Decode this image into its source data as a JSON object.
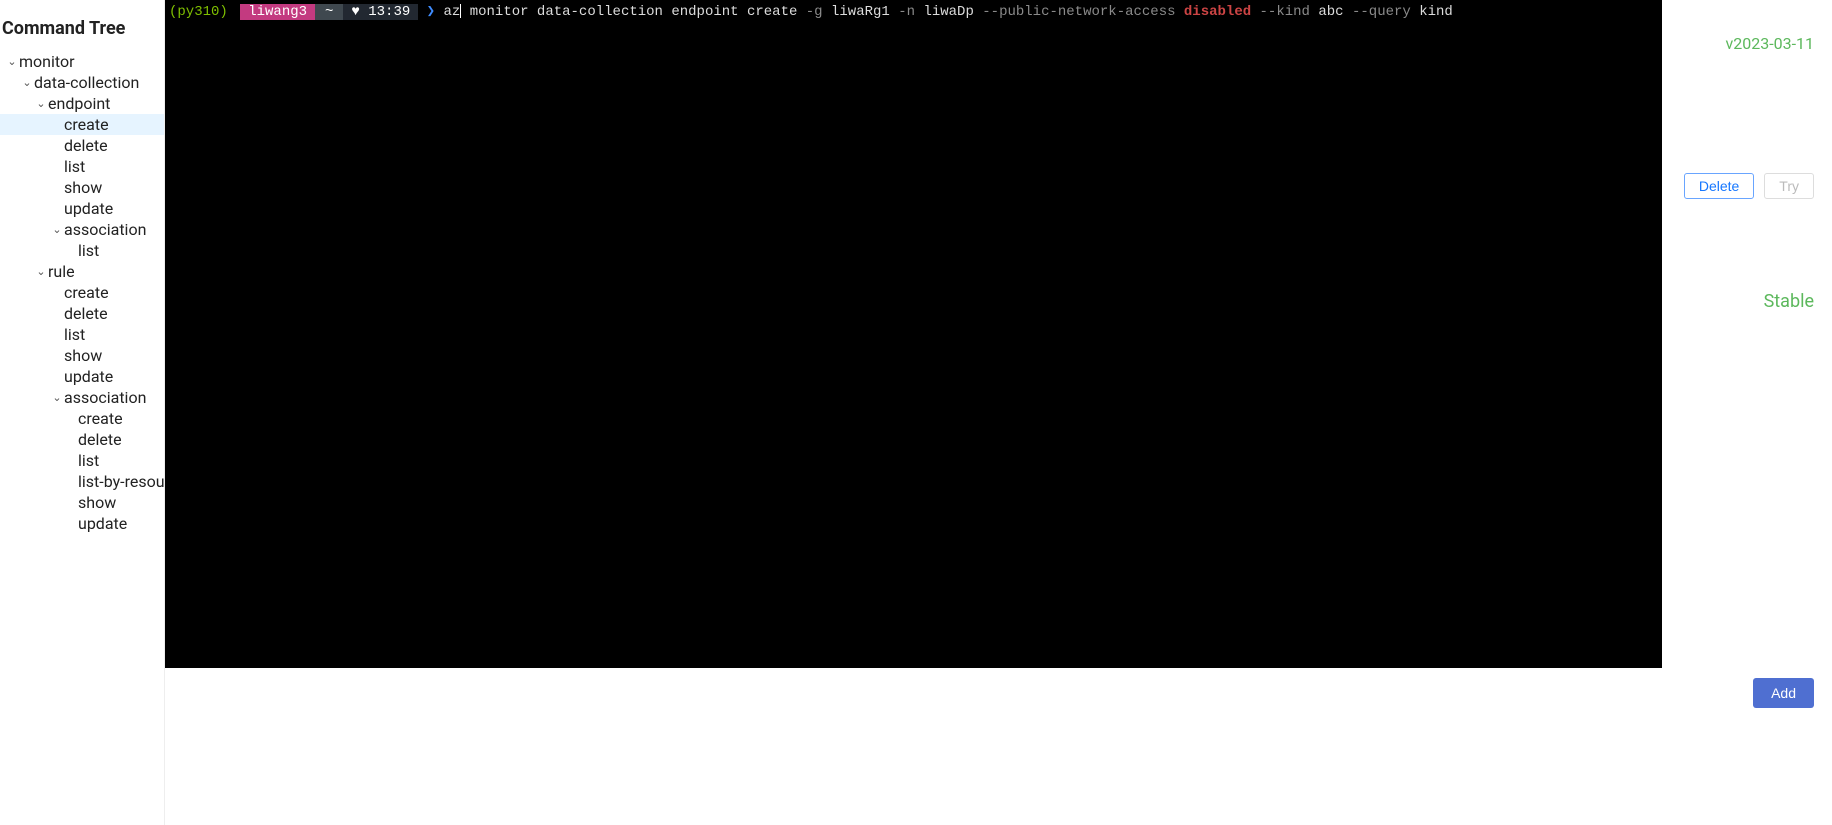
{
  "sidebar": {
    "title": "Command Tree",
    "tree": {
      "monitor": {
        "label": "monitor",
        "data_collection": {
          "label": "data-collection",
          "endpoint": {
            "label": "endpoint",
            "create": "create",
            "delete": "delete",
            "list": "list",
            "show": "show",
            "update": "update",
            "association": {
              "label": "association",
              "list": "list"
            }
          },
          "rule": {
            "label": "rule",
            "create": "create",
            "delete": "delete",
            "list": "list",
            "show": "show",
            "update": "update",
            "association": {
              "label": "association",
              "create": "create",
              "delete": "delete",
              "list": "list",
              "list_by_resource": "list-by-resource",
              "show": "show",
              "update": "update"
            }
          }
        }
      }
    }
  },
  "terminal": {
    "env": "(py310)",
    "user": "liwang3",
    "home_seg": "~",
    "heart": "♥",
    "time": "13:39",
    "cmd_az": "az",
    "cmd_rest": "monitor data-collection endpoint create",
    "flag_g": "-g",
    "val_g": "liwaRg1",
    "flag_n": "-n",
    "val_n": "liwaDp",
    "flag_pna": "--public-network-access",
    "val_pna": "disabled",
    "flag_kind": "--kind",
    "val_kind": "abc",
    "flag_query": "--query",
    "val_query": "kind"
  },
  "right": {
    "version": "v2023-03-11",
    "delete_btn": "Delete",
    "try_btn": "Try",
    "status": "Stable",
    "add_btn": "Add"
  }
}
